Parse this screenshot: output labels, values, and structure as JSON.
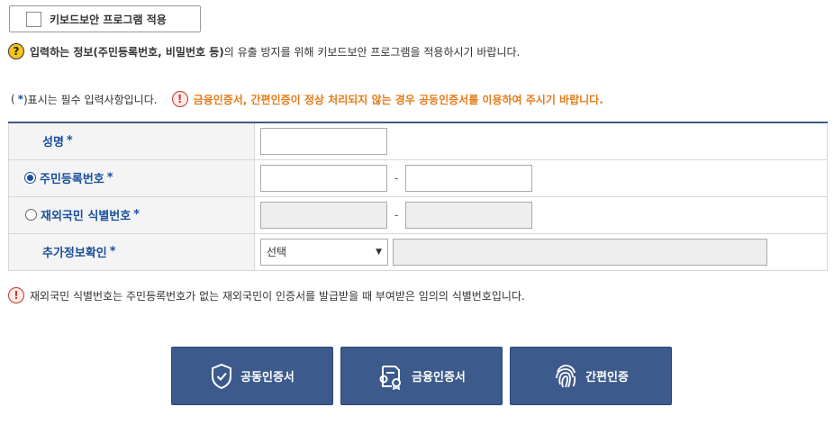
{
  "keyboard_security": {
    "label": "키보드보안 프로그램 적용",
    "checked": false
  },
  "help": {
    "icon": "question-icon",
    "bold_text": "입력하는 정보(주민등록번호, 비밀번호 등)",
    "text": "의 유출 방지를 위해 키보드보안 프로그램을 적용하시기 바랍니다."
  },
  "required_note": {
    "prefix": "(",
    "star": "*",
    "suffix": ")표시는 필수 입력사항입니다."
  },
  "warning": {
    "icon": "exclamation-icon",
    "text": "금융인증서, 간편인증이 정상 처리되지 않는 경우 공동인증서를 이용하여 주시기 바랍니다."
  },
  "form": {
    "name": {
      "label": "성명",
      "star": "*",
      "value": ""
    },
    "resident": {
      "label": "주민등록번호",
      "star": "*",
      "selected": true,
      "dash": "-"
    },
    "foreigner": {
      "label": "재외국민 식별번호",
      "star": "*",
      "selected": false,
      "dash": "-"
    },
    "extra": {
      "label": "추가정보확인",
      "star": "*",
      "select_value": "선택",
      "arrow": "▼"
    }
  },
  "note": {
    "icon": "exclamation-icon",
    "text": "재외국민 식별번호는 주민등록번호가 없는 재외국민이 인증서를 발급받을 때 부여받은 임의의 식별번호입니다."
  },
  "buttons": {
    "joint": {
      "label": "공동인증서",
      "icon": "shield-check-icon"
    },
    "financial": {
      "label": "금융인증서",
      "icon": "certificate-icon"
    },
    "simple": {
      "label": "간편인증",
      "icon": "fingerprint-icon"
    }
  },
  "colors": {
    "accent": "#3d5a8c",
    "label_blue": "#1a4f9c",
    "warning_orange": "#e47b1a",
    "help_yellow": "#f5c518"
  }
}
